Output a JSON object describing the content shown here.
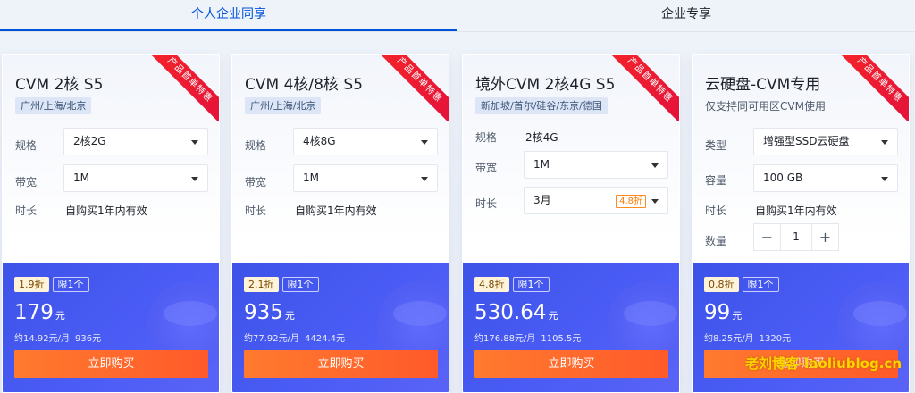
{
  "tabs": [
    {
      "label": "个人企业同享",
      "active": true
    },
    {
      "label": "企业专享",
      "active": false
    }
  ],
  "colors": {
    "accent": "#0052d9",
    "price_bg": "#4a5cf5",
    "buy": "#ff6a2c",
    "ribbon": "#f0232e"
  },
  "cards": [
    {
      "ribbon": "产品首单特惠",
      "title": "CVM 2核 S5",
      "tag": "广州/上海/北京",
      "rows": [
        {
          "label": "规格",
          "value": "2核2G"
        },
        {
          "label": "带宽",
          "value": "1M"
        },
        {
          "label": "时长",
          "value": "自购买1年内有效"
        }
      ],
      "discount": "1.9折",
      "limit": "限1个",
      "price": "179",
      "unit": "元",
      "monthly": "约14.92元/月",
      "original": "936元",
      "buy": "立即购买"
    },
    {
      "ribbon": "产品首单特惠",
      "title": "CVM 4核/8核 S5",
      "tag": "广州/上海/北京",
      "rows": [
        {
          "label": "规格",
          "value": "4核8G"
        },
        {
          "label": "带宽",
          "value": "1M"
        },
        {
          "label": "时长",
          "value": "自购买1年内有效"
        }
      ],
      "discount": "2.1折",
      "limit": "限1个",
      "price": "935",
      "unit": "元",
      "monthly": "约77.92元/月",
      "original": "4424.4元",
      "buy": "立即购买"
    },
    {
      "ribbon": "产品首单特惠",
      "title": "境外CVM 2核4G S5",
      "tag": "新加坡/首尔/硅谷/东京/德国",
      "rows": [
        {
          "label": "规格",
          "value": "2核4G"
        },
        {
          "label": "带宽",
          "value": "1M"
        },
        {
          "label": "时长",
          "value": "3月",
          "chip": "4.8折"
        }
      ],
      "discount": "4.8折",
      "limit": "限1个",
      "price": "530.64",
      "unit": "元",
      "monthly": "约176.88元/月",
      "original": "1105.5元",
      "buy": "立即购买"
    },
    {
      "ribbon": "产品首单特惠",
      "title": "云硬盘-CVM专用",
      "desc": "仅支持同可用区CVM使用",
      "rows": [
        {
          "label": "类型",
          "value": "增强型SSD云硬盘"
        },
        {
          "label": "容量",
          "value": "100 GB"
        },
        {
          "label": "时长",
          "value": "自购买1年内有效"
        },
        {
          "label": "数量",
          "value": "1",
          "minus": "−",
          "plus": "+"
        }
      ],
      "discount": "0.8折",
      "limit": "限1个",
      "price": "99",
      "unit": "元",
      "monthly": "约8.25元/月",
      "original": "1320元",
      "buy": "立即购买",
      "watermark": "老刘博客-laoliublog.cn"
    }
  ]
}
